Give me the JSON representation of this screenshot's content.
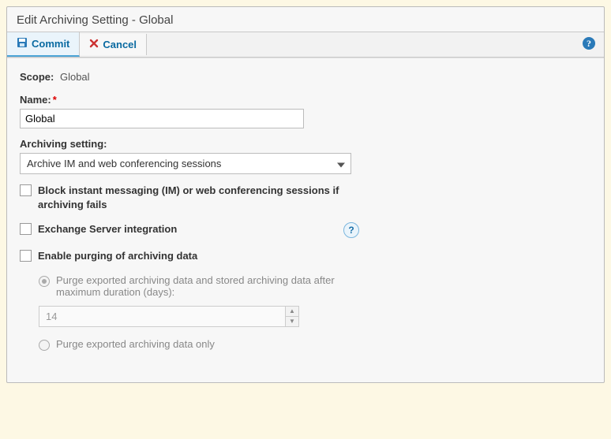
{
  "title": "Edit Archiving Setting - Global",
  "toolbar": {
    "commit": "Commit",
    "cancel": "Cancel"
  },
  "scope": {
    "label": "Scope:",
    "value": "Global"
  },
  "name": {
    "label": "Name:",
    "value": "Global"
  },
  "archiving_setting": {
    "label": "Archiving setting:",
    "value": "Archive IM and web conferencing sessions"
  },
  "options": {
    "block_on_fail": "Block instant messaging (IM) or web conferencing sessions if archiving fails",
    "exchange_integration": "Exchange Server integration",
    "enable_purge": "Enable purging of archiving data"
  },
  "purge": {
    "radio1": "Purge exported archiving data and stored archiving data after maximum duration (days):",
    "days": "14",
    "radio2": "Purge exported archiving data only"
  },
  "help_tooltip": "?"
}
